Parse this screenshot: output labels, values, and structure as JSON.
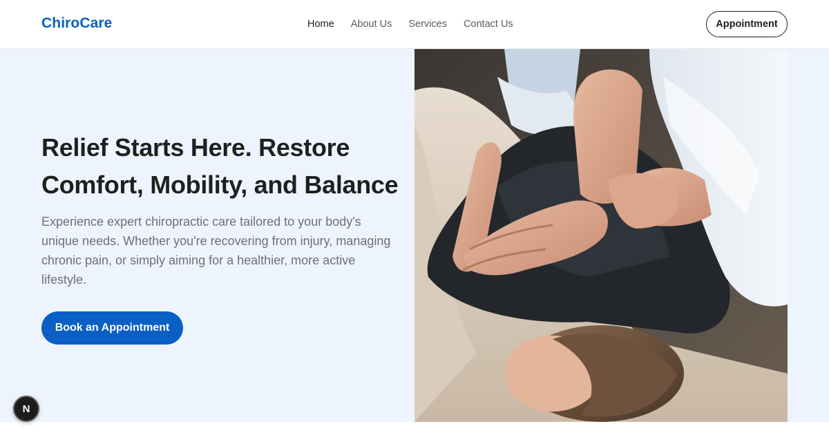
{
  "brand": {
    "name": "ChiroCare",
    "color": "#0a5fc4"
  },
  "nav": {
    "items": [
      {
        "label": "Home",
        "active": true
      },
      {
        "label": "About Us",
        "active": false
      },
      {
        "label": "Services",
        "active": false
      },
      {
        "label": "Contact Us",
        "active": false
      }
    ],
    "cta_label": "Appointment"
  },
  "hero": {
    "title": "Relief Starts Here. Restore Comfort, Mobility, and Balance",
    "description": "Experience expert chiropractic care tailored to your body's unique needs. Whether you're recovering from injury, managing chronic pain, or simply aiming for a healthier, more active lifestyle.",
    "button_label": "Book an Appointment",
    "photo_icon": "chiropractic-adjustment-photo"
  },
  "dev_badge": {
    "label": "N"
  },
  "colors": {
    "accent": "#0a5fc4",
    "hero_bg": "#eef4fd",
    "text": "#1f1f1f",
    "muted": "#6b7079"
  }
}
